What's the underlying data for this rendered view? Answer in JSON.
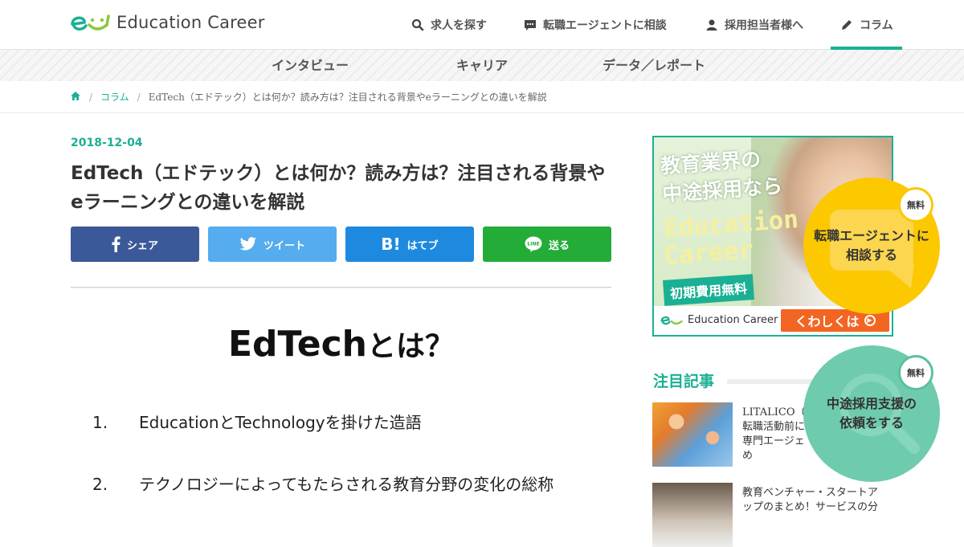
{
  "header": {
    "logo_text": "Education Career",
    "nav": [
      {
        "label": "求人を探す",
        "icon": "search-icon"
      },
      {
        "label": "転職エージェントに相談",
        "icon": "chat-icon"
      },
      {
        "label": "採用担当者様へ",
        "icon": "user-icon"
      },
      {
        "label": "コラム",
        "icon": "pencil-icon",
        "active": true
      }
    ]
  },
  "subnav": [
    "インタビュー",
    "キャリア",
    "データ／レポート"
  ],
  "breadcrumb": {
    "home_icon": "home-icon",
    "items": [
      "コラム",
      "EdTech（エドテック）とは何か？読み方は？注目される背景やeラーニングとの違いを解説"
    ]
  },
  "article": {
    "date": "2018-12-04",
    "title": "EdTech（エドテック）とは何か？読み方は？注目される背景やeラーニングとの違いを解説",
    "share": {
      "facebook": "シェア",
      "twitter": "ツイート",
      "hatena": "はてブ",
      "line": "送る"
    },
    "hero_heading_main": "EdTech",
    "hero_heading_tail": "とは？",
    "list": [
      {
        "num": "1.",
        "text": "EducationとTechnologyを掛けた造語"
      },
      {
        "num": "2.",
        "text": "テクノロジーによってもたらされる教育分野の変化の総称"
      }
    ]
  },
  "sidebar": {
    "banner": {
      "line1": "教育業界の",
      "line2": "中途採用なら",
      "brand1": "Education",
      "brand2": "Career",
      "free": "初期費用無料",
      "logo_text": "Education Career",
      "cta": "くわしくは"
    },
    "popular_heading": "注目記事",
    "popular": [
      {
        "text": "LITALICO（\n転職活動前に\n専門エージェ\nめ"
      },
      {
        "text": "教育ベンチャー・スタートア\nップのまとめ！サービスの分"
      }
    ]
  },
  "floating": {
    "agent": {
      "badge": "無料",
      "label_line1": "転職エージェントに",
      "label_line2": "相談する"
    },
    "recruit": {
      "badge": "無料",
      "label_line1": "中途採用支援の",
      "label_line2": "依頼をする"
    }
  },
  "colors": {
    "accent": "#1bb093",
    "facebook": "#3b5998",
    "twitter": "#55acee",
    "hatena": "#1d8ae0",
    "line": "#23ac38",
    "yellow": "#fcc800",
    "teal": "#6fcbae"
  }
}
